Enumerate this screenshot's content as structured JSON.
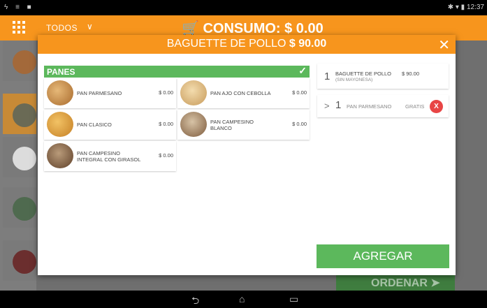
{
  "statusbar": {
    "left_icons": "ϟ ≡ ■",
    "time": "12:37",
    "right_icons": "✱ ▾ ▮"
  },
  "appbar": {
    "category": "TODOS",
    "category_chevron": "∨",
    "consumo": "CONSUMO: $ 0.00"
  },
  "background": {
    "ordenar_label": "ORDENAR"
  },
  "dialog": {
    "title_name": "BAGUETTE DE POLLO",
    "title_price": "$ 90.00",
    "close": "✕",
    "section": {
      "title": "PANES",
      "check": "✓"
    },
    "options": [
      {
        "name": "PAN PARMESANO",
        "price": "$ 0.00"
      },
      {
        "name": "PAN AJO CON CEBOLLA",
        "price": "$ 0.00"
      },
      {
        "name": "PAN CLASICO",
        "price": "$ 0.00"
      },
      {
        "name": "PAN CAMPESINO BLANCO",
        "price": "$ 0.00"
      },
      {
        "name": "PAN CAMPESINO INTEGRAL CON GIRASOL",
        "price": "$ 0.00"
      }
    ],
    "summary": {
      "qty": "1",
      "name": "BAGUETTE DE POLLO",
      "note": "(SIN MAYONESA)",
      "price": "$ 90.00"
    },
    "selected_option": {
      "arrow": ">",
      "qty": "1",
      "name": "PAN PARMESANO",
      "price": "GRATIS",
      "remove": "X"
    },
    "add_button": "AGREGAR"
  },
  "navbar": {
    "back": "⮌",
    "home": "⌂",
    "recents": "▭"
  },
  "colors": {
    "accent": "#f7951d",
    "green": "#5cb85c",
    "remove": "#e84545"
  }
}
